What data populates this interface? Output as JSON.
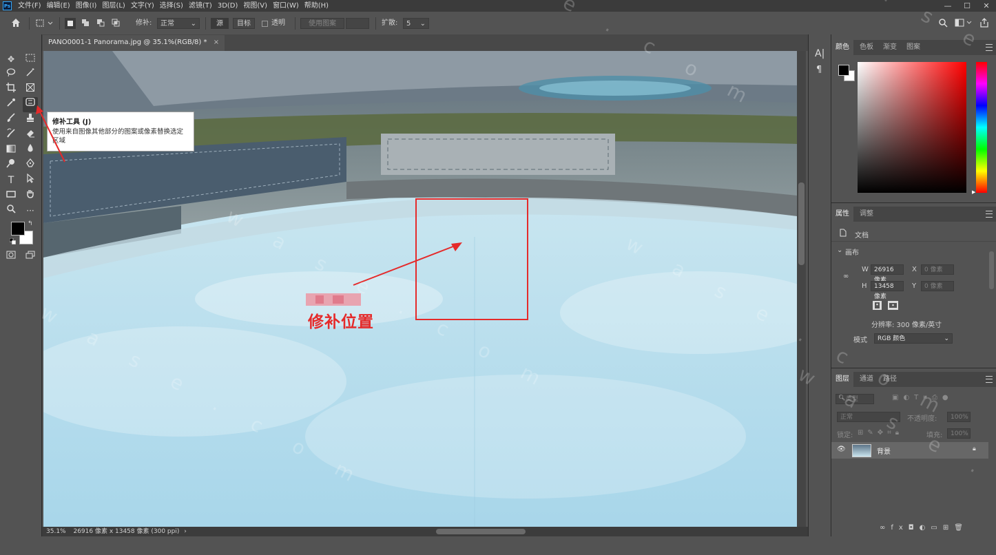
{
  "app": {
    "logo_text": "Ps"
  },
  "menu": [
    "文件(F)",
    "编辑(E)",
    "图像(I)",
    "图层(L)",
    "文字(Y)",
    "选择(S)",
    "滤镜(T)",
    "3D(D)",
    "视图(V)",
    "窗口(W)",
    "帮助(H)"
  ],
  "window_controls": {
    "minimize": "—",
    "maximize": "☐",
    "close": "✕"
  },
  "options_bar": {
    "patch_label": "修补:",
    "patch_mode": "正常",
    "source_label": "源",
    "target_label": "目标",
    "transparent_label": "透明",
    "use_pattern_label": "使用图案",
    "diffusion_label": "扩散:",
    "diffusion_value": "5"
  },
  "document": {
    "tab_title": "PANO0001-1 Panorama.jpg @ 35.1%(RGB/8) *",
    "tab_close": "×",
    "status_zoom": "35.1%",
    "status_info": "26916 像素 x 13458 像素 (300 ppi)"
  },
  "tooltip": {
    "title": "修补工具 (J)",
    "description": "使用来自图像其他部分的图案或像素替换选定区域"
  },
  "annotation": {
    "label": "修补位置"
  },
  "watermark_text": "w a s e . c o m",
  "panels": {
    "color_tabs": [
      "颜色",
      "色板",
      "渐变",
      "图案"
    ],
    "colors": {
      "foreground": "#000000",
      "background": "#ffffff",
      "hue_base": "#ff0000"
    },
    "properties_tabs": [
      "属性",
      "调整"
    ],
    "properties": {
      "doc_label": "文档",
      "canvas_section": "画布",
      "w_label": "W",
      "w_value": "26916 像素",
      "x_label": "X",
      "x_value": "0 像素",
      "h_label": "H",
      "h_value": "13458 像素",
      "y_label": "Y",
      "y_value": "0 像素",
      "resolution": "分辨率: 300 像素/英寸",
      "mode_label": "模式",
      "mode_value": "RGB 颜色"
    },
    "layers_tabs": [
      "图层",
      "通道",
      "路径"
    ],
    "layers": {
      "search_placeholder": "类型",
      "blend_mode": "正常",
      "opacity_label": "不透明度:",
      "opacity_value": "100%",
      "lock_label": "锁定:",
      "fill_label": "填充:",
      "fill_value": "100%",
      "layer_name": "背景"
    }
  }
}
